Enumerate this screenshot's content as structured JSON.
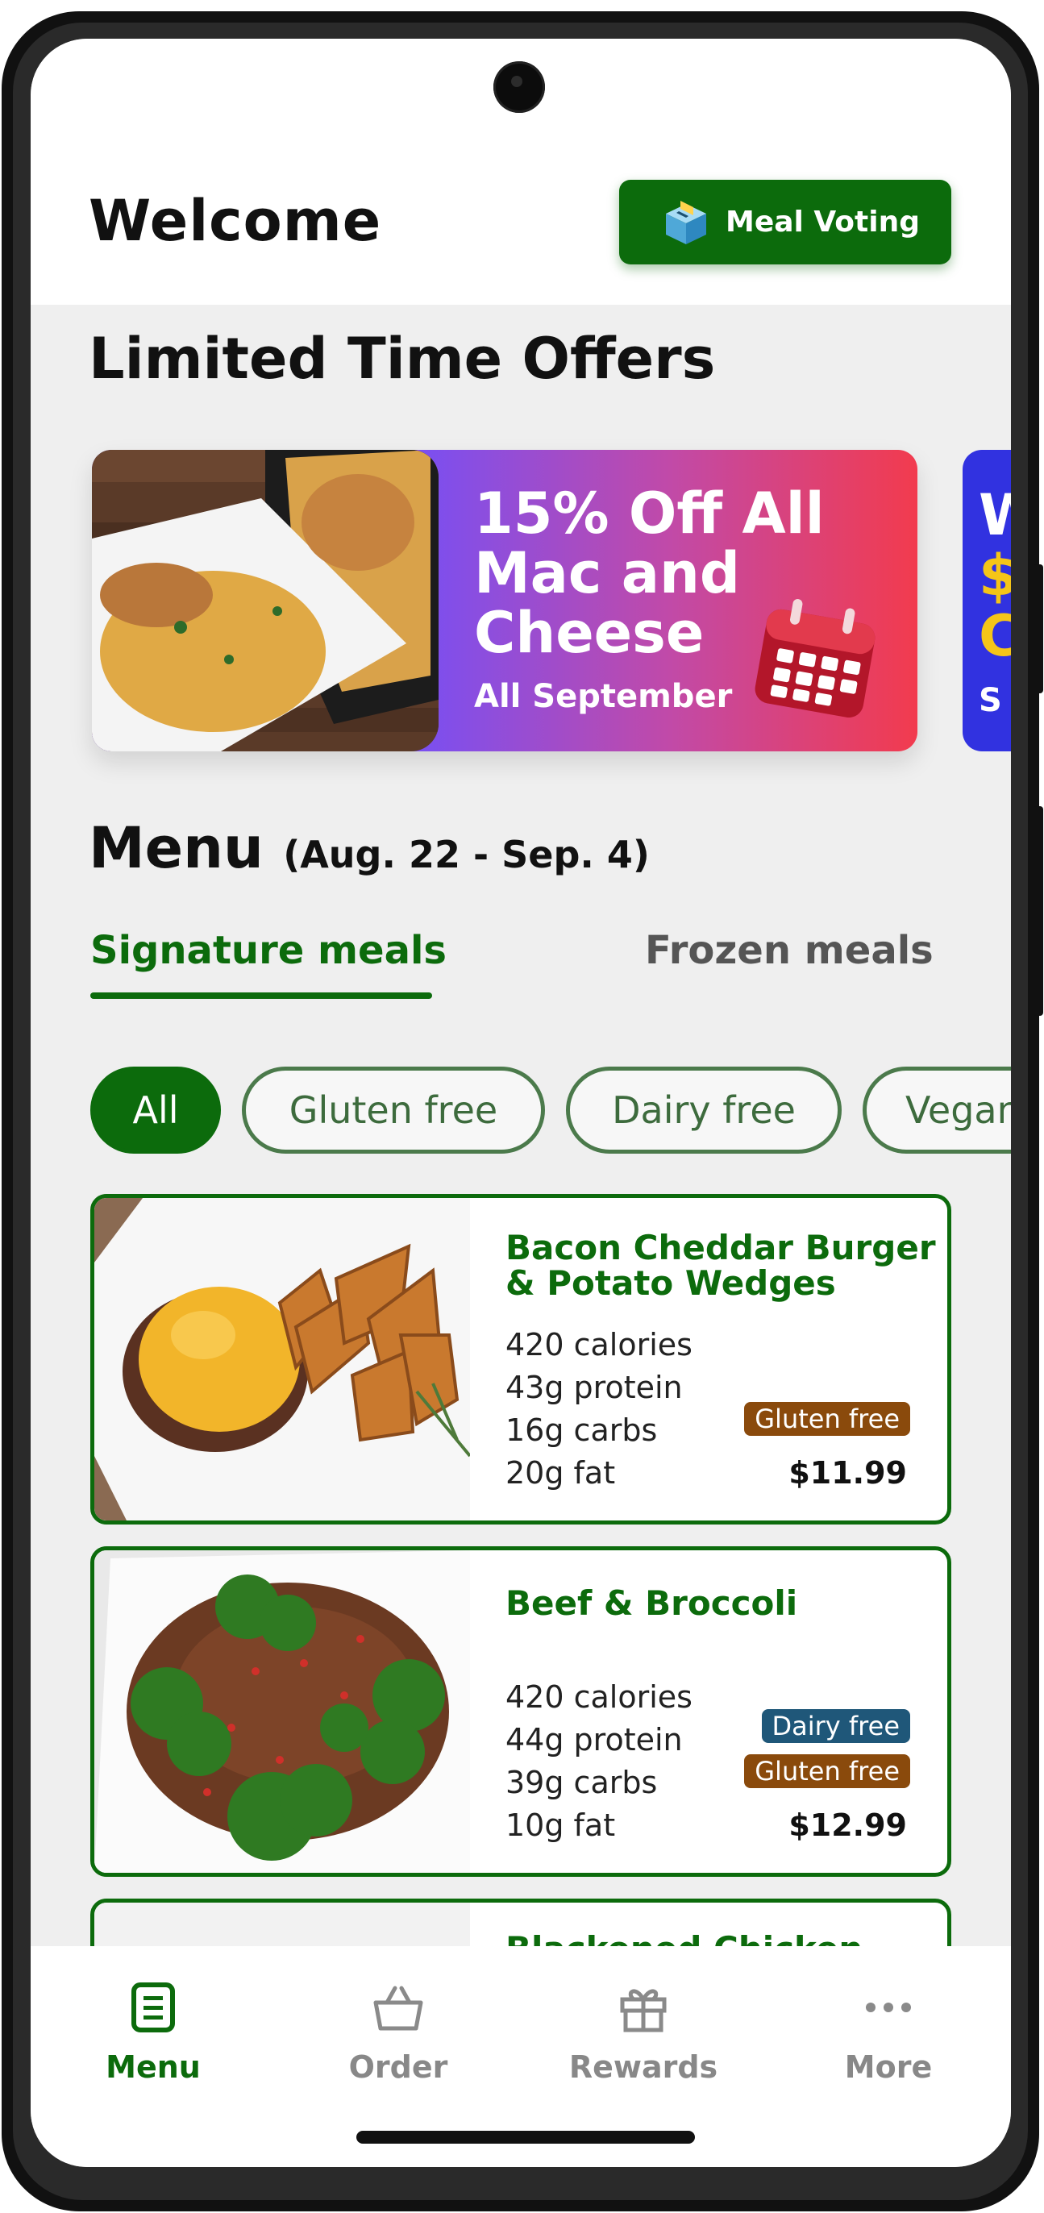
{
  "header": {
    "welcome": "Welcome",
    "vote_button_label": "Meal Voting",
    "vote_icon": "ballot-box-icon"
  },
  "offers": {
    "title": "Limited Time Offers",
    "items": [
      {
        "line1": "15% Off All",
        "line2": "Mac and",
        "line3": "Cheese",
        "subtitle": "All September",
        "icon": "calendar-icon"
      }
    ],
    "next_fragment": [
      "W",
      "$",
      "C",
      "S"
    ]
  },
  "menu": {
    "title": "Menu",
    "date_range": "(Aug. 22 - Sep. 4)",
    "tabs": [
      {
        "label": "Signature meals",
        "active": true
      },
      {
        "label": "Frozen meals",
        "active": false
      }
    ],
    "filters": [
      {
        "label": "All",
        "active": true
      },
      {
        "label": "Gluten free",
        "active": false
      },
      {
        "label": "Dairy free",
        "active": false
      },
      {
        "label": "Vegan",
        "active": false
      }
    ],
    "items": [
      {
        "name": "Bacon Cheddar Burger & Potato Wedges",
        "calories": "420 calories",
        "protein": "43g protein",
        "carbs": "16g carbs",
        "fat": "20g fat",
        "badges": [
          "Gluten free"
        ],
        "price": "$11.99"
      },
      {
        "name": "Beef & Broccoli",
        "calories": "420 calories",
        "protein": "44g protein",
        "carbs": "39g carbs",
        "fat": "10g fat",
        "badges": [
          "Dairy free",
          "Gluten free"
        ],
        "price": "$12.99"
      },
      {
        "name": "Blackened Chicken"
      }
    ]
  },
  "nav": {
    "items": [
      {
        "label": "Menu",
        "icon": "menu-icon",
        "active": true
      },
      {
        "label": "Order",
        "icon": "basket-icon",
        "active": false
      },
      {
        "label": "Rewards",
        "icon": "gift-icon",
        "active": false
      },
      {
        "label": "More",
        "icon": "more-icon",
        "active": false
      }
    ]
  },
  "colors": {
    "brand_green": "#0c6b0c",
    "gluten_badge": "#8a4a0c",
    "dairy_badge": "#1f5779"
  }
}
